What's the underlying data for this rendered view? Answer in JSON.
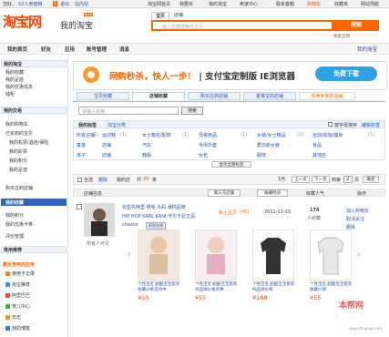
{
  "topbar": {
    "greeting": "您好，",
    "user": "52人参植物",
    "login_badge": "1",
    "logout": "退出",
    "messages": "站内信",
    "items": [
      "淘宝网首页",
      "我要买",
      "我的淘宝",
      "卖家中心",
      "联系客服",
      "购物车",
      "收藏夹",
      "网站导航"
    ]
  },
  "header": {
    "logo": "淘宝网",
    "subtitle": "我的淘宝",
    "beta": "Beta",
    "search_tabs": [
      "宝贝",
      "店铺"
    ],
    "search_placeholder": "输入您要搜索的宝贝",
    "search_button": "搜索",
    "top_right_link": "搜索全网"
  },
  "nav": {
    "items": [
      "我的首页",
      "好友",
      "应用",
      "账号管理",
      "消息"
    ],
    "right_link": "我的淘宝"
  },
  "sidebar": {
    "sections": [
      {
        "title": "我的淘宝",
        "items": [
          "我的收藏",
          "我的足迹",
          "我的优惠信息",
          "钱柜"
        ]
      },
      {
        "title": "我的交易",
        "items": [
          "我的购物车",
          "已买到的宝贝",
          "我的机票/酒店/保险",
          "我的彩票",
          "我的积分",
          "我的足迹",
          "购买过的店铺",
          "我的收藏",
          "我的积分",
          "我的优惠卡券",
          "评价管理"
        ]
      },
      {
        "title": "常用推荐",
        "items": [
          "使用卡记录",
          "淘宝推荐",
          "阿里巴巴",
          "育儿中心",
          "日志",
          "我的博客"
        ]
      }
    ],
    "active_item": "我的收藏",
    "apps_title": "最近使用的应用"
  },
  "banner": {
    "left": "网购秒杀，快人一步！",
    "right": "支付宝定制版 IE浏览器",
    "button": "免费下载"
  },
  "tabs": [
    "宝贝收藏",
    "店铺收藏",
    "购买过的店铺",
    "客谁宝的店铺",
    "热卖卖家的店铺"
  ],
  "store_search": {
    "placeholder": "请输入名称",
    "button": "搜索"
  },
  "labels": {
    "title": "我的标签",
    "group": "淘宝分类",
    "sort_checkbox": "按字母排序",
    "edit": "编辑标签",
    "rows": [
      [
        "所有店铺",
        "运动鞋",
        "女士箱包/配饰",
        "母婴用品",
        "女装/女士精品",
        "运动/瑜伽/健身"
      ],
      [
        "童装",
        "店铺",
        "汽车",
        "毛呢外套",
        "群日新女装",
        "食品"
      ],
      [
        "亲子",
        "店铺",
        "韩版",
        "女包",
        "服饰",
        "其他店"
      ]
    ],
    "counts": [
      "(1)",
      "(1)",
      "(1)",
      "(1)",
      "(2)",
      "(1)"
    ],
    "show_all": "显示全部标签"
  },
  "ops": {
    "select_all": "全选",
    "delete": "删除",
    "my_shops": "我的店",
    "total_prefix": "共",
    "total": "20",
    "unit": "条",
    "page": "1/6",
    "prev": "上一页",
    "next": "下一页",
    "goto_label": "到第",
    "goto_value": "2",
    "page_unit": "页",
    "ok": "确定"
  },
  "table_header": [
    "店铺信息",
    "第三方店铺",
    "收藏时间",
    "收藏人气",
    "操作"
  ],
  "store": {
    "name": "双型先锋里·嘻哈 大码 潮搞品牌",
    "desc": "HIP HOP KARL KANI·卡尔卡尼正品",
    "seller": "chasoo",
    "badges": "旺旺在线",
    "favorite_count_label": "所有人可见",
    "new_items": "新上宝贝",
    "new_count": "(40)",
    "date": "2011-11-23",
    "popularity": "174",
    "popularity_label": "人收藏",
    "actions": [
      "加入购物车",
      "取消关注",
      "删除"
    ],
    "shop_promo": "同店铺其他商品"
  },
  "products": [
    {
      "desc": "个性宝宝 超酷宝宝套装 收藏价格活动中",
      "price": "55"
    },
    {
      "desc": "个性宝宝 超酷宝宝套装 纯品牌价格优惠",
      "price": "55"
    },
    {
      "desc": "个性宝宝 超酷宝宝套装 纯品牌价格",
      "price": "168"
    },
    {
      "desc": "个性宝宝 超酷宝宝套装 收藏价格",
      "price": "55"
    }
  ],
  "watermark": "本帮网",
  "watermark_url": "www.zhubajie.com"
}
